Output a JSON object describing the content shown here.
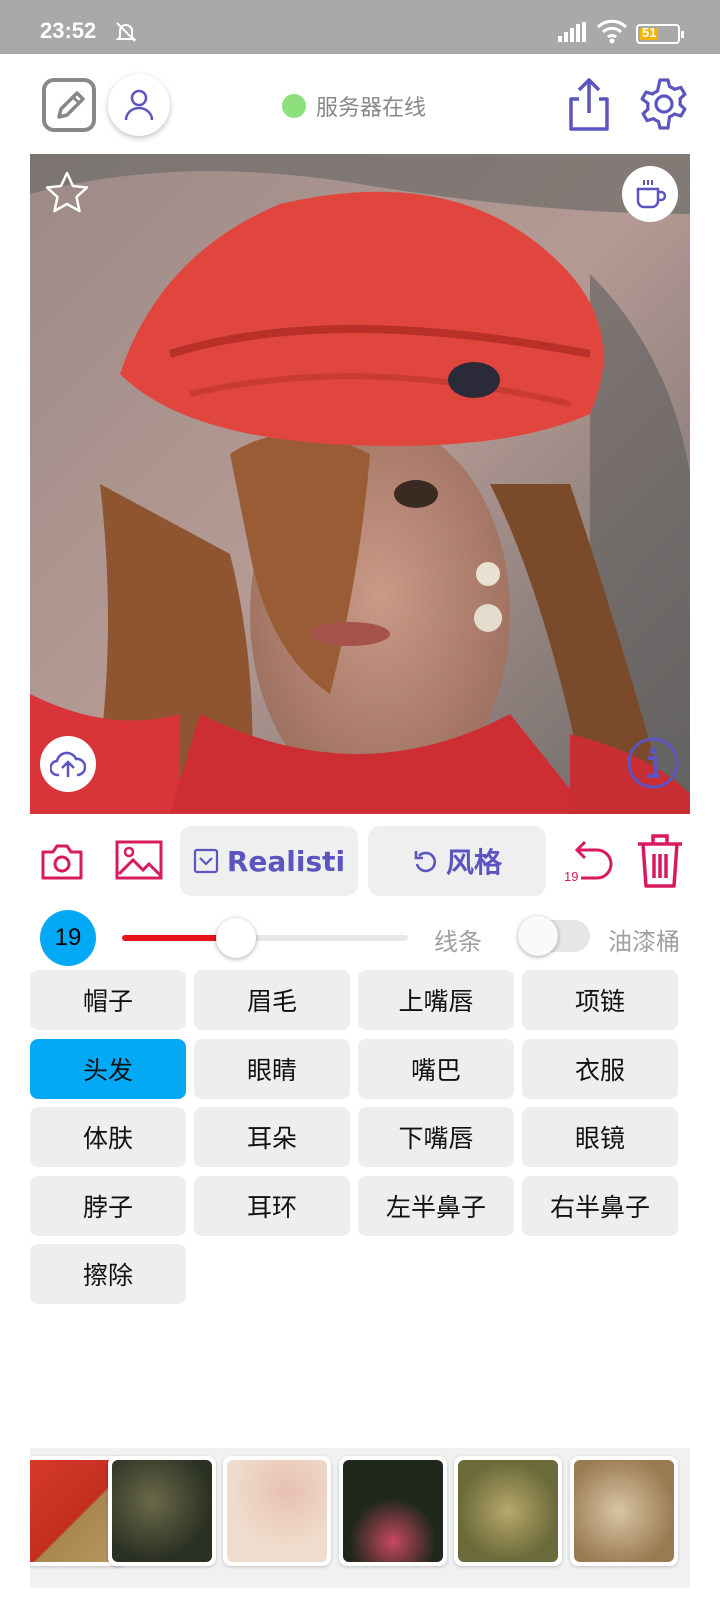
{
  "status_bar": {
    "time": "23:52",
    "battery": "51"
  },
  "header": {
    "server_status": "服务器在线"
  },
  "toolbar": {
    "model_label": "Realisti",
    "style_label": "风格",
    "undo_count": "19"
  },
  "brush": {
    "size": "19",
    "size_fraction": 0.4,
    "lines_label": "线条",
    "bucket_label": "油漆桶",
    "bucket_enabled": false
  },
  "parts": [
    "帽子",
    "眉毛",
    "上嘴唇",
    "项链",
    "头发",
    "眼睛",
    "嘴巴",
    "衣服",
    "体肤",
    "耳朵",
    "下嘴唇",
    "眼镜",
    "脖子",
    "耳环",
    "左半鼻子",
    "右半鼻子",
    "擦除"
  ],
  "selected_part": "头发",
  "colors": {
    "accent": "#5c55c0",
    "danger": "#d81b60",
    "selected": "#03a9f4",
    "online": "#8ee07c",
    "slider_fill": "#e8131b"
  }
}
